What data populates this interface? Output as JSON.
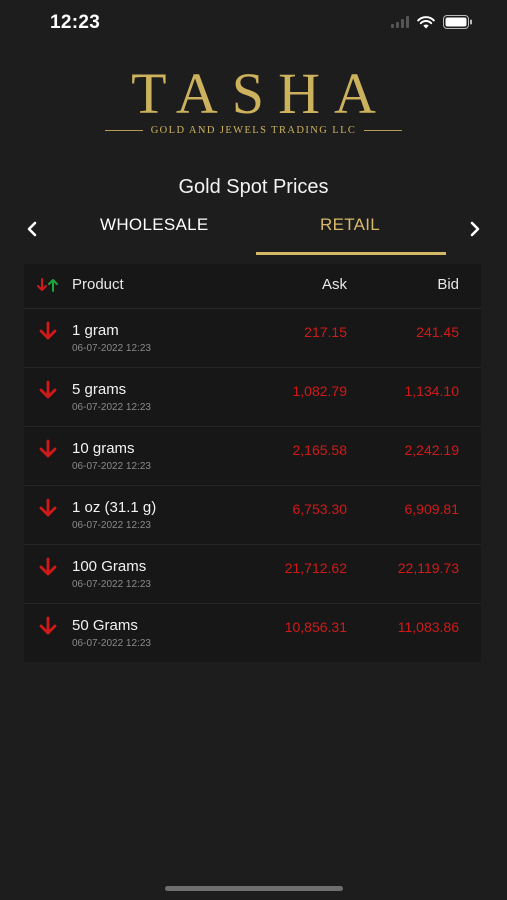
{
  "status_bar": {
    "time": "12:23"
  },
  "logo": {
    "word": "TASHA",
    "subtitle": "GOLD AND JEWELS TRADING LLC"
  },
  "title": "Gold Spot Prices",
  "tabs": [
    {
      "label": "WHOLESALE",
      "active": false
    },
    {
      "label": "RETAIL",
      "active": true
    }
  ],
  "table": {
    "headers": {
      "product": "Product",
      "ask": "Ask",
      "bid": "Bid"
    },
    "rows": [
      {
        "product": "1 gram",
        "date": "06-07-2022 12:23",
        "ask": "217.15",
        "bid": "241.45",
        "trend": "down"
      },
      {
        "product": "5 grams",
        "date": "06-07-2022 12:23",
        "ask": "1,082.79",
        "bid": "1,134.10",
        "trend": "down"
      },
      {
        "product": "10 grams",
        "date": "06-07-2022 12:23",
        "ask": "2,165.58",
        "bid": "2,242.19",
        "trend": "down"
      },
      {
        "product": "1 oz (31.1 g)",
        "date": "06-07-2022 12:23",
        "ask": "6,753.30",
        "bid": "6,909.81",
        "trend": "down"
      },
      {
        "product": "100 Grams",
        "date": "06-07-2022 12:23",
        "ask": "21,712.62",
        "bid": "22,119.73",
        "trend": "down"
      },
      {
        "product": "50 Grams",
        "date": "06-07-2022 12:23",
        "ask": "10,856.31",
        "bid": "11,083.86",
        "trend": "down"
      }
    ]
  },
  "colors": {
    "accent_gold": "#d3b865",
    "down_red": "#d01a1a",
    "up_green": "#1fa33a",
    "background": "#1e1d1d"
  }
}
